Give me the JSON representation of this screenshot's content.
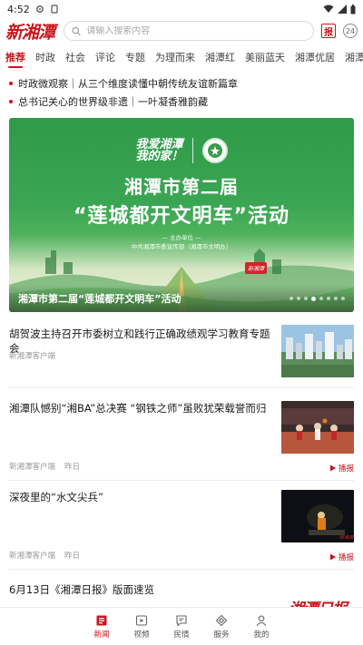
{
  "status_bar": {
    "time": "4:52"
  },
  "header": {
    "logo_text": "新湘潭",
    "search_placeholder": "请输入搜索内容",
    "paper_icon_text": "报",
    "news24_icon_text": "24"
  },
  "tabs": [
    {
      "label": "推荐",
      "active": true
    },
    {
      "label": "时政"
    },
    {
      "label": "社会"
    },
    {
      "label": "评论"
    },
    {
      "label": "专题"
    },
    {
      "label": "为理而来"
    },
    {
      "label": "湘潭红"
    },
    {
      "label": "美丽蓝天"
    },
    {
      "label": "湘潭优居"
    },
    {
      "label": "湘潭资讯"
    }
  ],
  "headlines": [
    "时政微观察｜从三个维度读懂中朝传统友谊新篇章",
    "总书记关心的世界级非遗｜一叶凝香雅韵藏"
  ],
  "banner": {
    "slogan_line1": "我爱湘潭",
    "slogan_line2": "我的家！",
    "title_line1": "湘潭市第二届",
    "title_line2": "“莲城都开文明车”活动",
    "organizer_label": "— 主办单位 —",
    "organizer": "中共湘潭市委宣传部（湘潭市文明办）",
    "seal_text": "新湘潭",
    "caption": "湘潭市第二届“莲城都开文明车”活动",
    "pager_count": 8,
    "pager_active": 4
  },
  "news": [
    {
      "title": "胡贺波主持召开市委树立和践行正确政绩观学习教育专题会",
      "source": "新湘潭客户端",
      "time": "",
      "has_video": false,
      "thumb": "city-skyline"
    },
    {
      "title": "湘潭队憾别“湘BA”总决赛 “钢铁之师”虽败犹荣载誉而归",
      "source": "新湘潭客户端",
      "time": "昨日",
      "has_video": true,
      "video_label": "播报",
      "thumb": "basketball-court"
    },
    {
      "title": "深夜里的“水文尖兵”",
      "source": "新湘潭客户端",
      "time": "昨日",
      "has_video": true,
      "video_label": "播报",
      "thumb": "night-hydrology"
    },
    {
      "title": "6月13日《湘潭日报》版面速览",
      "source": "",
      "time": "",
      "has_video": false,
      "thumb": "newspaper-masthead",
      "thumb_text": "湘潭日报"
    }
  ],
  "bottom_nav": [
    {
      "label": "新闻",
      "icon": "news-icon",
      "active": true
    },
    {
      "label": "视频",
      "icon": "video-icon"
    },
    {
      "label": "民情",
      "icon": "feedback-icon"
    },
    {
      "label": "服务",
      "icon": "service-icon"
    },
    {
      "label": "我的",
      "icon": "profile-icon"
    }
  ],
  "colors": {
    "brand_red": "#c8161d",
    "banner_green": "#3aa653"
  }
}
